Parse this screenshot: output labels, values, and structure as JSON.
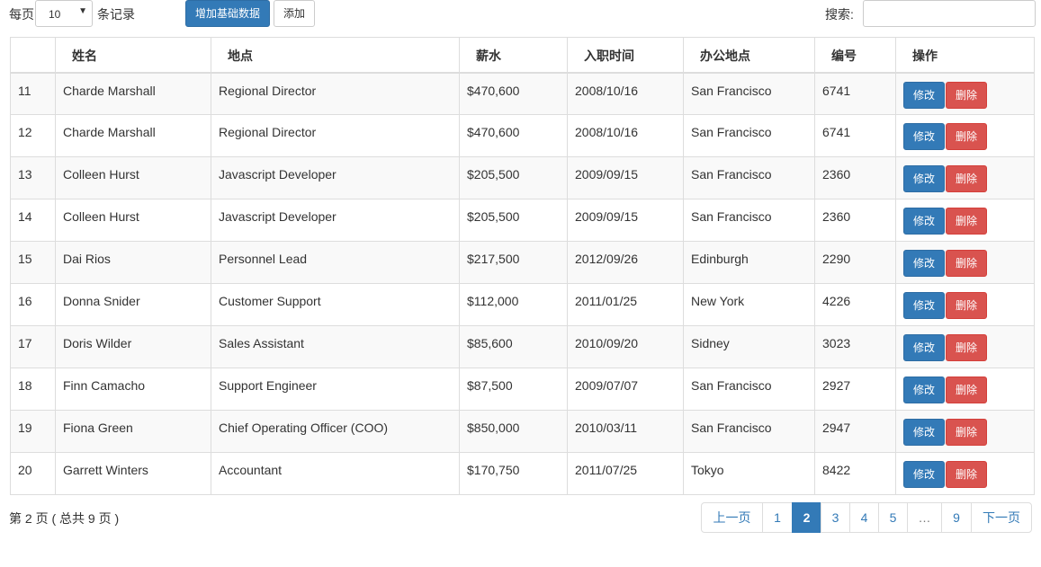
{
  "toolbar": {
    "per_page_prefix": "每页",
    "per_page_value": "10",
    "per_page_suffix": "条记录",
    "add_basic_button": "增加基础数据",
    "add_button": "添加",
    "search_label": "搜索:"
  },
  "table": {
    "columns": [
      "",
      "姓名",
      "地点",
      "薪水",
      "入职时间",
      "办公地点",
      "编号",
      "操作"
    ],
    "edit_label": "修改",
    "delete_label": "删除",
    "rows": [
      [
        "11",
        "Charde Marshall",
        "Regional Director",
        "$470,600",
        "2008/10/16",
        "San Francisco",
        "6741"
      ],
      [
        "12",
        "Charde Marshall",
        "Regional Director",
        "$470,600",
        "2008/10/16",
        "San Francisco",
        "6741"
      ],
      [
        "13",
        "Colleen Hurst",
        "Javascript Developer",
        "$205,500",
        "2009/09/15",
        "San Francisco",
        "2360"
      ],
      [
        "14",
        "Colleen Hurst",
        "Javascript Developer",
        "$205,500",
        "2009/09/15",
        "San Francisco",
        "2360"
      ],
      [
        "15",
        "Dai Rios",
        "Personnel Lead",
        "$217,500",
        "2012/09/26",
        "Edinburgh",
        "2290"
      ],
      [
        "16",
        "Donna Snider",
        "Customer Support",
        "$112,000",
        "2011/01/25",
        "New York",
        "4226"
      ],
      [
        "17",
        "Doris Wilder",
        "Sales Assistant",
        "$85,600",
        "2010/09/20",
        "Sidney",
        "3023"
      ],
      [
        "18",
        "Finn Camacho",
        "Support Engineer",
        "$87,500",
        "2009/07/07",
        "San Francisco",
        "2927"
      ],
      [
        "19",
        "Fiona Green",
        "Chief Operating Officer (COO)",
        "$850,000",
        "2010/03/11",
        "San Francisco",
        "2947"
      ],
      [
        "20",
        "Garrett Winters",
        "Accountant",
        "$170,750",
        "2011/07/25",
        "Tokyo",
        "8422"
      ]
    ]
  },
  "footer": {
    "info": "第 2 页 ( 总共 9 页 )",
    "pagination": {
      "prev": "上一页",
      "next": "下一页",
      "pages": [
        "1",
        "2",
        "3",
        "4",
        "5",
        "…",
        "9"
      ],
      "active": "2"
    }
  }
}
